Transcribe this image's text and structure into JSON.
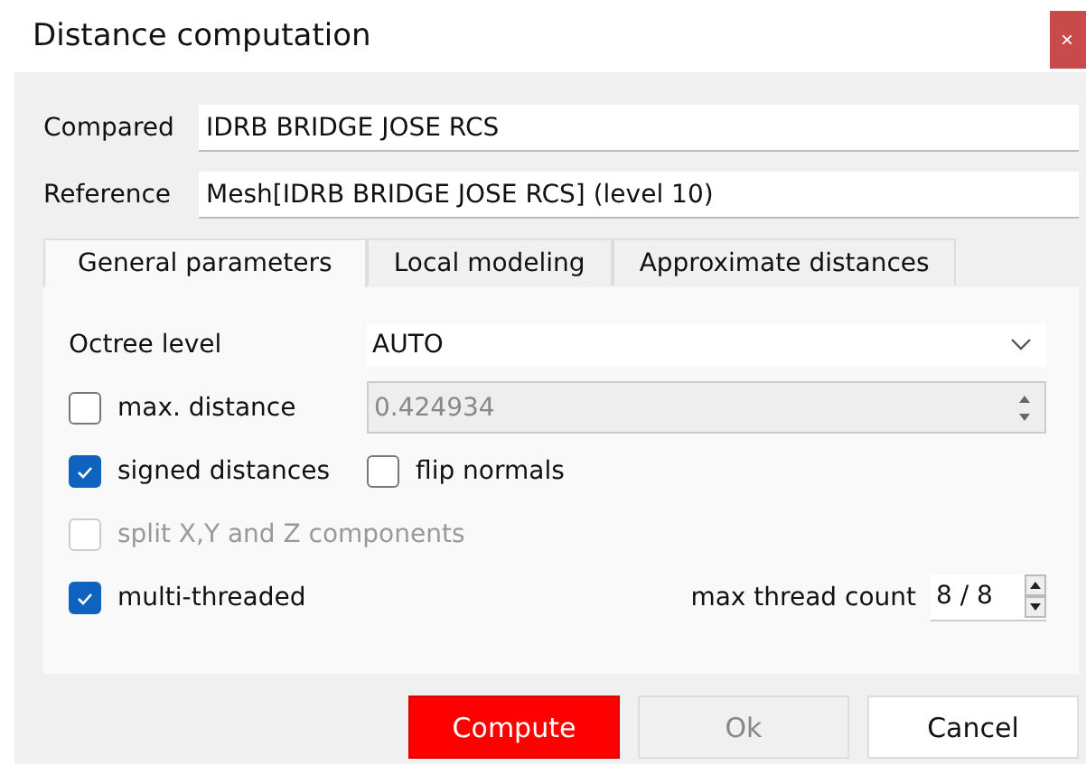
{
  "window": {
    "title": "Distance computation",
    "close": "×"
  },
  "fields": [
    {
      "label": "Compared",
      "value": "IDRB BRIDGE JOSE RCS"
    },
    {
      "label": "Reference",
      "value": "Mesh[IDRB BRIDGE JOSE RCS] (level 10)"
    }
  ],
  "tabs": [
    {
      "label": "General parameters",
      "selected": true
    },
    {
      "label": "Local modeling",
      "selected": false
    },
    {
      "label": "Approximate distances",
      "selected": false
    }
  ],
  "octree": {
    "label": "Octree level",
    "value": "AUTO"
  },
  "max_distance": {
    "label": "max. distance",
    "checked": false,
    "value": "0.424934",
    "disabled": true
  },
  "signed": {
    "label": "signed distances",
    "checked": true,
    "disabled": false
  },
  "flip": {
    "label": "flip normals",
    "checked": false,
    "disabled": false
  },
  "split": {
    "label": "split X,Y and Z components",
    "checked": false,
    "disabled": true
  },
  "multi": {
    "label": "multi-threaded",
    "checked": true,
    "disabled": false
  },
  "threads": {
    "label": "max thread count",
    "value": "8 / 8"
  },
  "buttons": [
    {
      "label": "Compute",
      "kind": "primary"
    },
    {
      "label": "Ok",
      "kind": "disabled"
    },
    {
      "label": "Cancel",
      "kind": "normal"
    }
  ]
}
